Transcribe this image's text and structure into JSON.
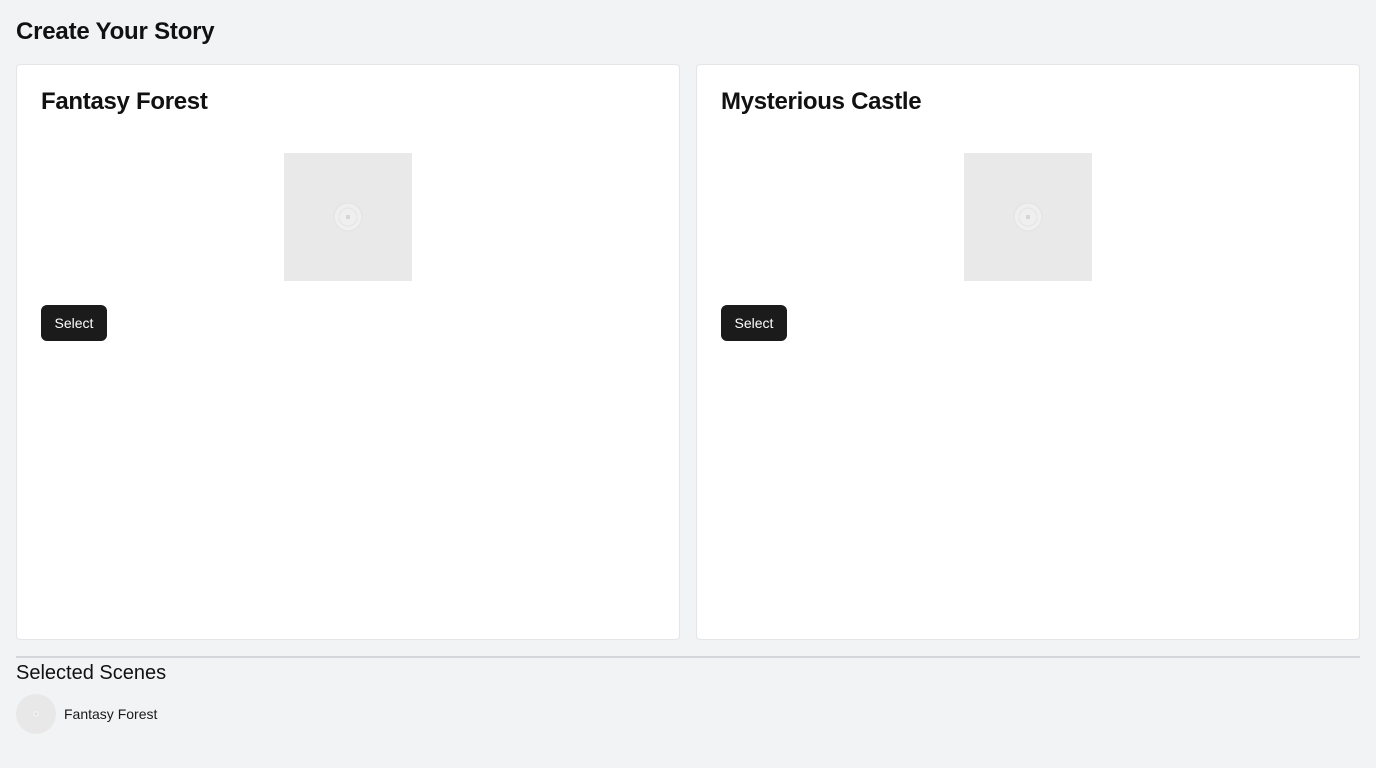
{
  "page": {
    "title": "Create Your Story"
  },
  "scenes": [
    {
      "title": "Fantasy Forest",
      "button_label": "Select",
      "image_icon": "image-placeholder-icon"
    },
    {
      "title": "Mysterious Castle",
      "button_label": "Select",
      "image_icon": "image-placeholder-icon"
    }
  ],
  "selected": {
    "heading": "Selected Scenes",
    "items": [
      {
        "label": "Fantasy Forest",
        "icon": "scene-thumbnail-icon"
      }
    ]
  },
  "colors": {
    "background": "#f2f3f5",
    "card": "#ffffff",
    "button": "#1b1b1b",
    "button_text": "#ffffff",
    "placeholder": "#e9e9e9"
  }
}
